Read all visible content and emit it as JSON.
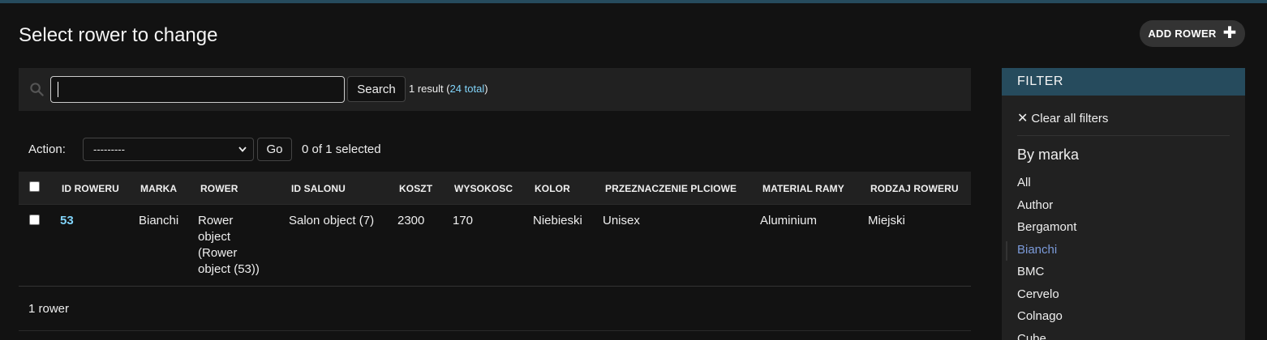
{
  "header": {
    "title": "Select rower to change",
    "add_label": "ADD ROWER"
  },
  "search": {
    "value": "",
    "button_label": "Search",
    "result_prefix": "1 result (",
    "result_total": "24 total",
    "result_suffix": ")"
  },
  "actions": {
    "label": "Action:",
    "select_value": "---------",
    "go_label": "Go",
    "selected_text": "0 of 1 selected"
  },
  "table": {
    "columns": [
      "ID ROWERU",
      "MARKA",
      "ROWER",
      "ID SALONU",
      "KOSZT",
      "WYSOKOSC",
      "KOLOR",
      "PRZEZNACZENIE PLCIOWE",
      "MATERIAL RAMY",
      "RODZAJ ROWERU"
    ],
    "rows": [
      {
        "id": "53",
        "marka": "Bianchi",
        "rower_lines": [
          "Rower",
          "object",
          "(Rower",
          "object (53))"
        ],
        "id_salonu": "Salon object (7)",
        "koszt": "2300",
        "wysokosc": "170",
        "kolor": "Niebieski",
        "przeznaczenie": "Unisex",
        "material": "Aluminium",
        "rodzaj": "Miejski"
      }
    ],
    "footer": "1 rower"
  },
  "filter": {
    "header": "FILTER",
    "clear_label": "Clear all filters",
    "section_title": "By marka",
    "options": [
      "All",
      "Author",
      "Bergamont",
      "Bianchi",
      "BMC",
      "Cervelo",
      "Colnago",
      "Cube"
    ],
    "selected": "Bianchi"
  },
  "colors": {
    "accent": "#264b5d",
    "link": "#81d4fa",
    "active_filter": "#7b9ad9",
    "background": "#121212",
    "panel": "#212121"
  }
}
